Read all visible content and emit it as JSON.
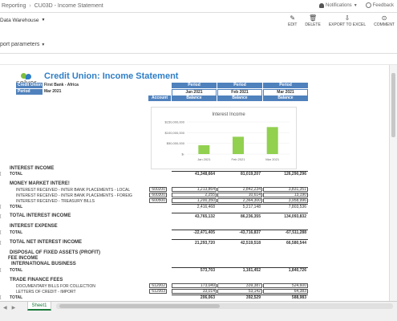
{
  "breadcrumb": {
    "root": "Reporting",
    "page": "CU03D - Income Statement"
  },
  "topbar": {
    "notifications": "Notifications",
    "feedback": "Feedback"
  },
  "source": {
    "label": "Data Warehouse"
  },
  "toolbar": {
    "edit": "EDIT",
    "delete": "DELETE",
    "export": "EXPORT TO EXCEL",
    "comment": "COMMENT"
  },
  "params": {
    "label": "port parameters"
  },
  "report": {
    "logo": "solver",
    "title": "Credit Union: Income Statement",
    "credit_union_label": "Credit Union",
    "credit_union_value": "First Bank - Africa",
    "period_label": "Period",
    "period_value": "Mar 2021",
    "col_header": "Period",
    "columns": [
      "Jan 2021",
      "Feb 2021",
      "Mar 2021"
    ],
    "account_label": "Account",
    "balance_label": "Balance"
  },
  "chart_data": {
    "type": "bar",
    "title": "Interest Income",
    "categories": [
      "Jan 2021",
      "Feb 2021",
      "Mar 2021"
    ],
    "values": [
      41348664,
      81019207,
      126290296
    ],
    "ylim": [
      0,
      150000000
    ],
    "yticks": [
      "$150,000,000",
      "$100,000,000",
      "$50,000,000",
      "$-"
    ],
    "color": "#92d050"
  },
  "sections": {
    "interest_income": {
      "title": "INTEREST INCOME",
      "total_label": "TOTAL",
      "values": [
        "41,348,664",
        "81,019,207",
        "126,290,296"
      ]
    },
    "money_market": {
      "title": "MONEY MARKET INTERE!",
      "rows": [
        {
          "label": "INTEREST RECEIVED - INTER BANK PLACEMENTS - LOCAL",
          "code": "600200",
          "values": [
            "1,213,864",
            "2,842,234",
            "3,831,351"
          ]
        },
        {
          "label": "INTEREST RECEIVED - INTER BANK PLACEMENTS - FOREIG",
          "code": "600300",
          "values": [
            "2,255",
            "10,614",
            "13,190"
          ]
        },
        {
          "label": "INTEREST RECEIVED - TREASURY BILLS",
          "code": "600500",
          "values": [
            "1,200,350",
            "2,364,300",
            "3,958,996"
          ]
        }
      ],
      "total_label": "TOTAL",
      "values": [
        "2,416,468",
        "5,217,148",
        "7,803,536"
      ]
    },
    "total_interest_income": {
      "label": "TOTAL INTEREST INCOME",
      "values": [
        "43,765,132",
        "86,236,355",
        "134,093,832"
      ]
    },
    "interest_expense": {
      "title": "INTEREST EXPENSE",
      "total_label": "TOTAL",
      "values": [
        "-22,471,405",
        "-43,716,837",
        "-67,511,288"
      ]
    },
    "total_net_interest_income": {
      "label": "TOTAL NET INTEREST INCOME",
      "values": [
        "21,293,720",
        "42,519,518",
        "66,580,544"
      ]
    },
    "disposal": {
      "title": "DISPOSAL OF FIXED ASSETS (PROFIT)"
    },
    "fee_income": {
      "title": "FEE INCOME"
    },
    "international_business": {
      "title": "INTERNATIONAL BUSINESS",
      "total_label": "TOTAL",
      "values": [
        "573,703",
        "1,161,452",
        "1,840,726"
      ]
    },
    "trade_finance": {
      "title": "TRADE FINANCE FEES",
      "rows": [
        {
          "label": "DOCUMENTARY BILLS FOR COLLECTION",
          "code": "612002",
          "values": [
            "173,049",
            "339,387",
            "524,600"
          ]
        },
        {
          "label": "LETTERS OF CREDIT - IMPORT",
          "code": "612003",
          "values": [
            "33,014",
            "53,142",
            "64,383"
          ]
        }
      ],
      "total_label": "TOTAL",
      "values": [
        "206,063",
        "392,529",
        "588,983"
      ]
    }
  },
  "sheet_tab": "Sheet1"
}
